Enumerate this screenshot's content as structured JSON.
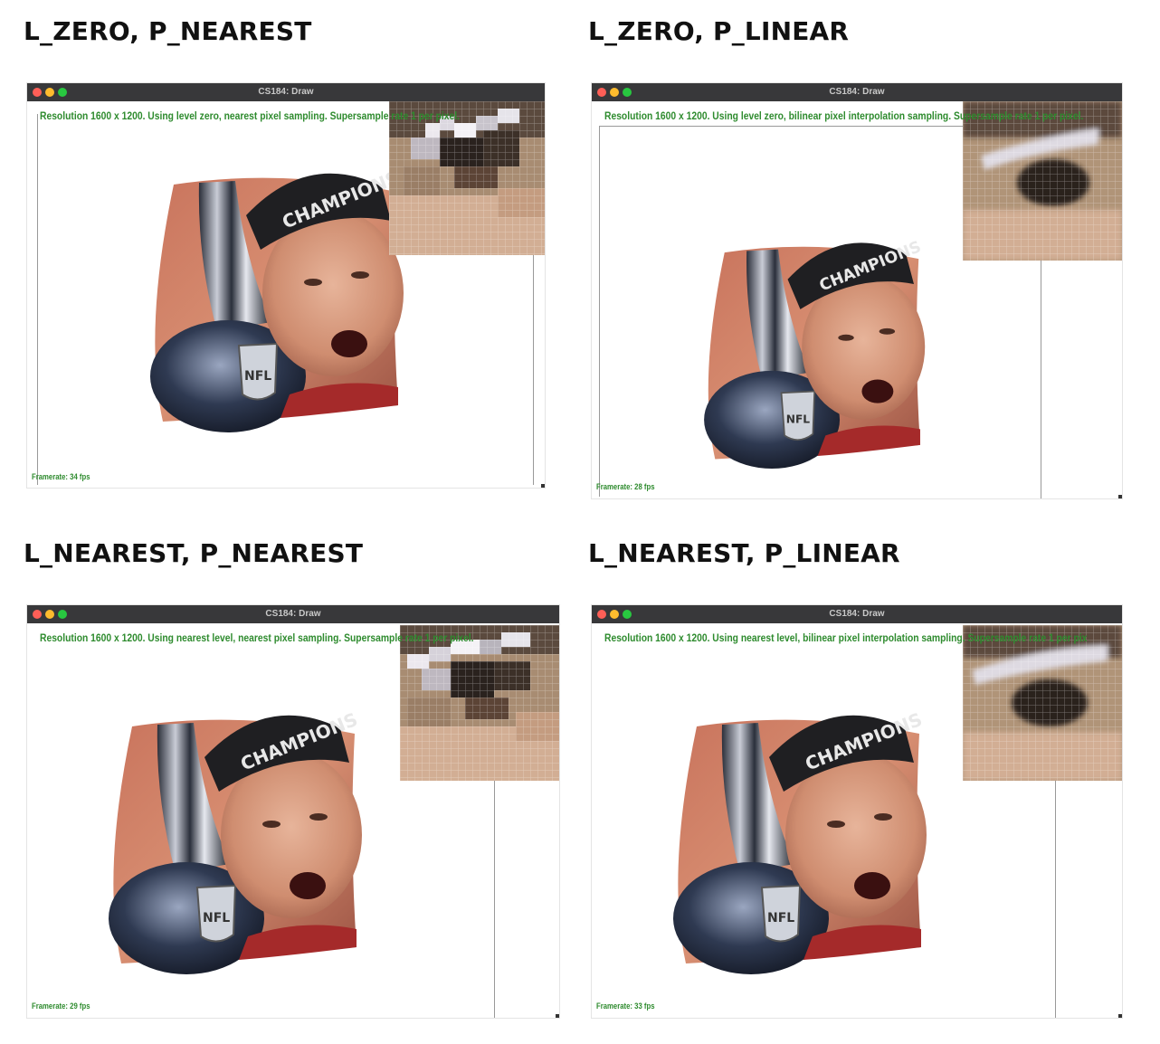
{
  "panels": [
    {
      "heading": "L_ZERO, P_NEAREST",
      "window_title": "CS184: Draw",
      "status": "Resolution 1600 x 1200. Using level zero, nearest pixel sampling. Supersample rate 1 per pixel.",
      "framerate": "Framerate: 34 fps",
      "sampling": "nearest"
    },
    {
      "heading": "L_ZERO, P_LINEAR",
      "window_title": "CS184: Draw",
      "status": "Resolution 1600 x 1200. Using level zero, bilinear pixel interpolation sampling. Supersample rate 1 per pixel.",
      "framerate": "Framerate: 28 fps",
      "sampling": "linear"
    },
    {
      "heading": "L_NEAREST, P_NEAREST",
      "window_title": "CS184: Draw",
      "status": "Resolution 1600 x 1200. Using nearest level, nearest pixel sampling. Supersample rate 1 per pixel.",
      "framerate": "Framerate: 29 fps",
      "sampling": "nearest"
    },
    {
      "heading": "L_NEAREST, P_LINEAR",
      "window_title": "CS184: Draw",
      "status": "Resolution 1600 x 1200. Using nearest level, bilinear pixel interpolation sampling. Supersample rate 1 per pix",
      "framerate": "Framerate: 33 fps",
      "sampling": "linear"
    }
  ],
  "image_text": {
    "cap_text": "CHAMPIONS",
    "logo_text": "NFL"
  },
  "colors": {
    "status_green": "#2e8b2e",
    "titlebar": "#38383a"
  }
}
